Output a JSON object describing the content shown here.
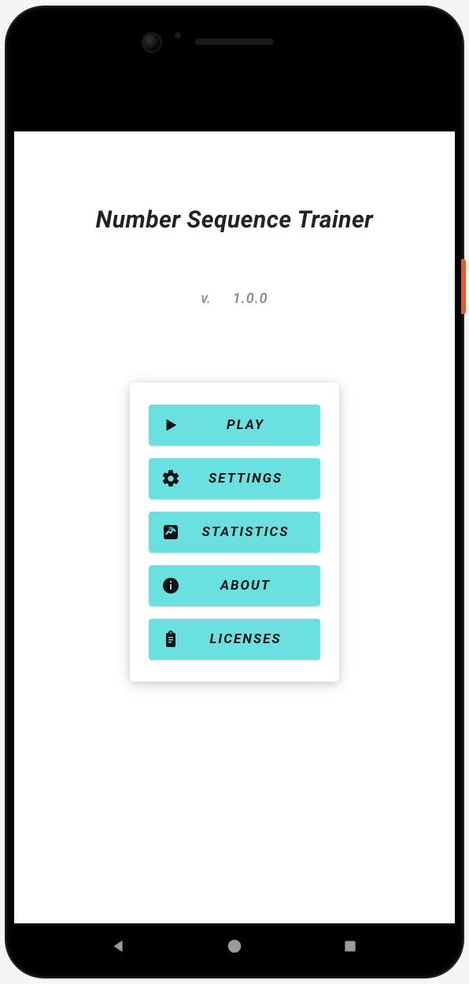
{
  "app": {
    "title": "Number Sequence Trainer",
    "version_label": "v.",
    "version_value": "1.0.0"
  },
  "menu": {
    "items": [
      {
        "label": "PLAY",
        "icon": "play-icon"
      },
      {
        "label": "SETTINGS",
        "icon": "gear-icon"
      },
      {
        "label": "STATISTICS",
        "icon": "stats-icon"
      },
      {
        "label": "ABOUT",
        "icon": "info-icon"
      },
      {
        "label": "LICENSES",
        "icon": "clipboard-icon"
      }
    ]
  },
  "colors": {
    "button_bg": "#6ae0e0",
    "text_dark": "#111",
    "text_muted": "#8a8a8a"
  }
}
